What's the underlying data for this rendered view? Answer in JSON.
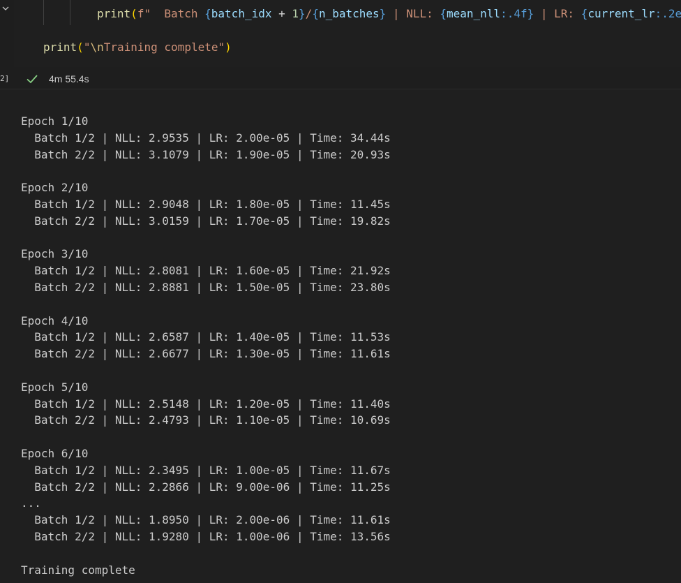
{
  "cell": {
    "execution_count": "2]",
    "exec_time": "4m 55.4s",
    "icons": {
      "collapse": "chevron-down-icon",
      "status": "check-icon"
    },
    "code_lines": [
      [
        {
          "t": "print",
          "c": "tok-fn"
        },
        {
          "t": "(",
          "c": "tok-paren-y"
        },
        {
          "t": "f\"  Batch ",
          "c": "tok-str"
        },
        {
          "t": "{",
          "c": "tok-brace"
        },
        {
          "t": "batch_idx",
          "c": "tok-var"
        },
        {
          "t": " + ",
          "c": "tok-plain"
        },
        {
          "t": "1",
          "c": "tok-num"
        },
        {
          "t": "}",
          "c": "tok-brace"
        },
        {
          "t": "/",
          "c": "tok-str"
        },
        {
          "t": "{",
          "c": "tok-brace"
        },
        {
          "t": "n_batches",
          "c": "tok-var"
        },
        {
          "t": "}",
          "c": "tok-brace"
        },
        {
          "t": " | NLL: ",
          "c": "tok-str"
        },
        {
          "t": "{",
          "c": "tok-brace"
        },
        {
          "t": "mean_nll",
          "c": "tok-var"
        },
        {
          "t": ":.4f",
          "c": "tok-spec"
        },
        {
          "t": "}",
          "c": "tok-brace"
        },
        {
          "t": " | LR: ",
          "c": "tok-str"
        },
        {
          "t": "{",
          "c": "tok-brace"
        },
        {
          "t": "current_lr",
          "c": "tok-var"
        },
        {
          "t": ":.2e",
          "c": "tok-spec"
        }
      ],
      [
        {
          "t": "print",
          "c": "tok-fn"
        },
        {
          "t": "(",
          "c": "tok-paren-y"
        },
        {
          "t": "\"",
          "c": "tok-str"
        },
        {
          "t": "\\n",
          "c": "tok-esc"
        },
        {
          "t": "Training complete\"",
          "c": "tok-str"
        },
        {
          "t": ")",
          "c": "tok-paren-y"
        }
      ]
    ]
  },
  "output": {
    "lines": [
      "Epoch 1/10",
      "  Batch 1/2 | NLL: 2.9535 | LR: 2.00e-05 | Time: 34.44s",
      "  Batch 2/2 | NLL: 3.1079 | LR: 1.90e-05 | Time: 20.93s",
      "",
      "Epoch 2/10",
      "  Batch 1/2 | NLL: 2.9048 | LR: 1.80e-05 | Time: 11.45s",
      "  Batch 2/2 | NLL: 3.0159 | LR: 1.70e-05 | Time: 19.82s",
      "",
      "Epoch 3/10",
      "  Batch 1/2 | NLL: 2.8081 | LR: 1.60e-05 | Time: 21.92s",
      "  Batch 2/2 | NLL: 2.8881 | LR: 1.50e-05 | Time: 23.80s",
      "",
      "Epoch 4/10",
      "  Batch 1/2 | NLL: 2.6587 | LR: 1.40e-05 | Time: 11.53s",
      "  Batch 2/2 | NLL: 2.6677 | LR: 1.30e-05 | Time: 11.61s",
      "",
      "Epoch 5/10",
      "  Batch 1/2 | NLL: 2.5148 | LR: 1.20e-05 | Time: 11.40s",
      "  Batch 2/2 | NLL: 2.4793 | LR: 1.10e-05 | Time: 10.69s",
      "",
      "Epoch 6/10",
      "  Batch 1/2 | NLL: 2.3495 | LR: 1.00e-05 | Time: 11.67s",
      "  Batch 2/2 | NLL: 2.2866 | LR: 9.00e-06 | Time: 11.25s",
      "...",
      "  Batch 1/2 | NLL: 1.8950 | LR: 2.00e-06 | Time: 11.61s",
      "  Batch 2/2 | NLL: 1.9280 | LR: 1.00e-06 | Time: 13.56s",
      "",
      "Training complete"
    ]
  },
  "colors": {
    "background": "#1f1f1f",
    "success": "#89d185",
    "text": "#cccccc"
  }
}
